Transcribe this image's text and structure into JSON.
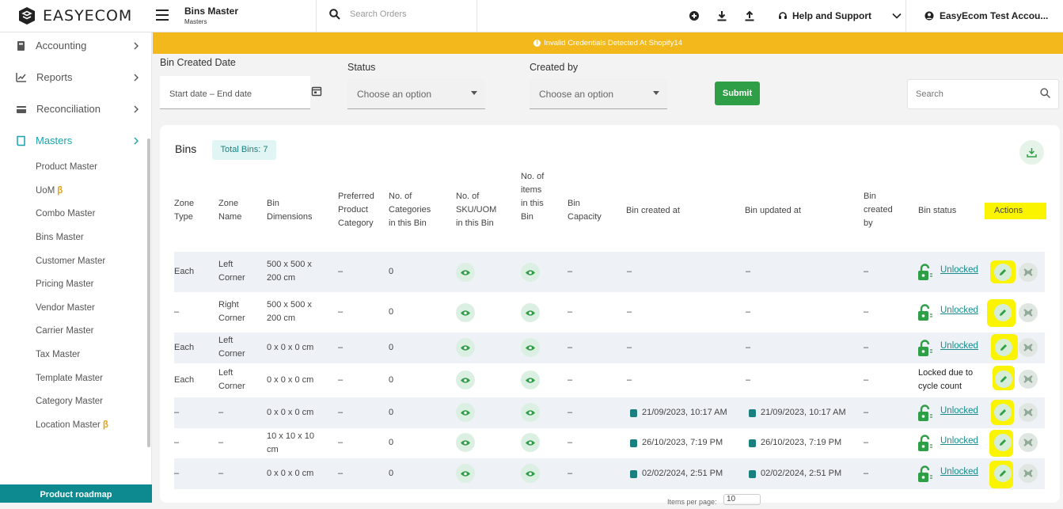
{
  "app": {
    "brand": "EASYECOM",
    "title": "Bins Master",
    "subtitle": "Masters"
  },
  "header": {
    "search_placeholder": "Search Orders",
    "help": "Help and Support",
    "user": "EasyEcom Test Accou..."
  },
  "alert": {
    "text": "Invalid Credentials Detected At Shopify14",
    "color": "#f3b81b"
  },
  "sidebar": {
    "main": [
      {
        "label": "Accounting"
      },
      {
        "label": "Reports"
      },
      {
        "label": "Reconciliation"
      },
      {
        "label": "Masters"
      }
    ],
    "sub": [
      {
        "label": "Product Master",
        "beta": ""
      },
      {
        "label": "UoM",
        "beta": "β"
      },
      {
        "label": "Combo Master",
        "beta": ""
      },
      {
        "label": "Bins Master",
        "beta": ""
      },
      {
        "label": "Customer Master",
        "beta": ""
      },
      {
        "label": "Pricing Master",
        "beta": ""
      },
      {
        "label": "Vendor Master",
        "beta": ""
      },
      {
        "label": "Carrier Master",
        "beta": ""
      },
      {
        "label": "Tax Master",
        "beta": ""
      },
      {
        "label": "Template Master",
        "beta": ""
      },
      {
        "label": "Category Master",
        "beta": ""
      },
      {
        "label": "Location Master",
        "beta": "β"
      }
    ],
    "roadmap": "Product roadmap"
  },
  "filters": {
    "bin_created_label": "Bin Created Date",
    "start": "Start date",
    "sep": "–",
    "end": "End date",
    "status_label": "Status",
    "status_value": "Choose an option",
    "created_by_label": "Created by",
    "created_by_value": "Choose an option",
    "submit": "Submit",
    "search_placeholder": "Search"
  },
  "table": {
    "title": "Bins",
    "total": "Total Bins: 7",
    "headers": [
      "Zone Type",
      "Zone Name",
      "Bin Dimensions",
      "Preferred Product Category",
      "No. of Categories in this Bin",
      "No. of SKU/UOM in this Bin",
      "No. of items in this Bin",
      "Bin Capacity",
      "Bin created at",
      "Bin updated at",
      "Bin created by",
      "Bin status",
      "Actions"
    ],
    "rows": [
      {
        "zone_type": "Each",
        "zone_name": "Left Corner",
        "dims": "500 x 500 x 200 cm",
        "pref": "–",
        "cats": "0",
        "cap": "–",
        "created": "–",
        "updated": "–",
        "by": "–",
        "status": "Unlocked",
        "locked": false
      },
      {
        "zone_type": "–",
        "zone_name": "Right Corner",
        "dims": "500 x 500 x 200 cm",
        "pref": "–",
        "cats": "0",
        "cap": "–",
        "created": "–",
        "updated": "–",
        "by": "–",
        "status": "Unlocked",
        "locked": false
      },
      {
        "zone_type": "Each",
        "zone_name": "Left Corner",
        "dims": "0 x 0 x 0 cm",
        "pref": "–",
        "cats": "0",
        "cap": "–",
        "created": "–",
        "updated": "–",
        "by": "–",
        "status": "Unlocked",
        "locked": false
      },
      {
        "zone_type": "Each",
        "zone_name": "Left Corner",
        "dims": "0 x 0 x 0 cm",
        "pref": "–",
        "cats": "0",
        "cap": "–",
        "created": "–",
        "updated": "–",
        "by": "–",
        "status": "Locked due to cycle count",
        "locked": true
      },
      {
        "zone_type": "–",
        "zone_name": "–",
        "dims": "0 x 0 x 0 cm",
        "pref": "–",
        "cats": "0",
        "cap": "–",
        "created": "21/09/2023, 10:17 AM",
        "updated": "21/09/2023, 10:17 AM",
        "by": "–",
        "status": "Unlocked",
        "locked": false
      },
      {
        "zone_type": "–",
        "zone_name": "–",
        "dims": "10 x 10 x 10 cm",
        "pref": "–",
        "cats": "0",
        "cap": "–",
        "created": "26/10/2023, 7:19 PM",
        "updated": "26/10/2023, 7:19 PM",
        "by": "–",
        "status": "Unlocked",
        "locked": false
      },
      {
        "zone_type": "–",
        "zone_name": "–",
        "dims": "0 x 0 x 0 cm",
        "pref": "–",
        "cats": "0",
        "cap": "–",
        "created": "02/02/2024, 2:51 PM",
        "updated": "02/02/2024, 2:51 PM",
        "by": "–",
        "status": "Unlocked",
        "locked": false
      }
    ],
    "items_per_page_label": "Items per page:",
    "items_per_page": "10"
  },
  "colors": {
    "teal": "#1aa3ad",
    "green": "#2e9f47",
    "highlight": "#fbf400"
  }
}
